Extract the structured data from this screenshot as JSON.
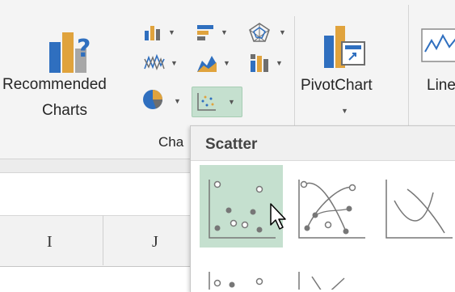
{
  "ribbon": {
    "recommended_charts": {
      "label_line1": "Recommended",
      "label_line2": "Charts",
      "icon": "recommended-charts-icon"
    },
    "chart_icons_row1": [
      "column-chart-icon",
      "bar-chart-icon",
      "radar-chart-icon"
    ],
    "chart_icons_row2": [
      "waterfall-chart-icon",
      "area-chart-icon",
      "combo-chart-icon"
    ],
    "chart_icons_row3": [
      "pie-chart-icon",
      "scatter-chart-icon"
    ],
    "group_label": "Cha",
    "pivot_chart": {
      "label": "PivotChart",
      "icon": "pivot-chart-icon"
    },
    "line_sparkline": {
      "label": "Line",
      "icon": "line-sparkline-icon"
    }
  },
  "sheet": {
    "columns": [
      "I",
      "J"
    ]
  },
  "gallery": {
    "title": "Scatter",
    "items": [
      {
        "name": "scatter",
        "selected": true
      },
      {
        "name": "scatter-smooth-lines-markers",
        "selected": false
      },
      {
        "name": "scatter-smooth-lines",
        "selected": false
      },
      {
        "name": "scatter-straight-lines-markers",
        "selected": false
      },
      {
        "name": "scatter-straight-lines",
        "selected": false
      }
    ]
  },
  "colors": {
    "ribbon_bg": "#f4f4f4",
    "selection_green": "#c5e0cf",
    "chart_blue": "#2f6fbf",
    "chart_gold": "#e0a33d",
    "icon_gray": "#6e6e6e"
  }
}
